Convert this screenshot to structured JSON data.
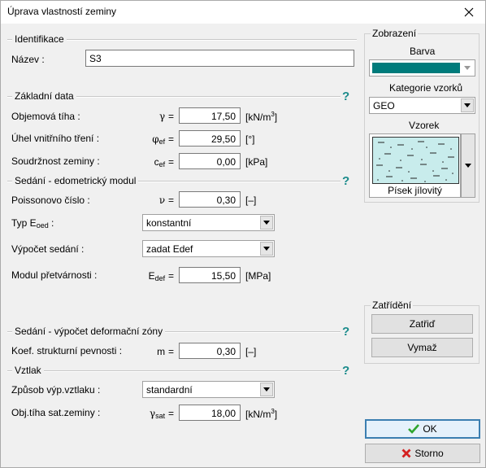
{
  "window": {
    "title": "Úprava vlastností zeminy"
  },
  "ident": {
    "section": "Identifikace",
    "name_label": "Název :",
    "name_value": "S3"
  },
  "basic": {
    "section": "Základní data",
    "help": "?",
    "unit_weight": {
      "label": "Objemová tíha :",
      "symbol": "γ",
      "eq": "=",
      "value": "17,50",
      "unit": "[kN/m",
      "unit_sup": "3",
      "unit_end": "]"
    },
    "friction": {
      "label": "Úhel vnitřního tření :",
      "symbol": "φ",
      "sub": "ef",
      "eq": "=",
      "value": "29,50",
      "unit": "[°]"
    },
    "cohesion": {
      "label": "Soudržnost zeminy :",
      "symbol": "c",
      "sub": "ef",
      "eq": "=",
      "value": "0,00",
      "unit": "[kPa]"
    }
  },
  "settle": {
    "section": "Sedání - edometrický modul",
    "help": "?",
    "poisson": {
      "label": "Poissonovo číslo :",
      "symbol": "ν",
      "eq": "=",
      "value": "0,30",
      "unit": "[–]"
    },
    "eoed_type": {
      "label": "Typ E",
      "label_sub": "oed",
      "label_end": " :",
      "value": "konstantní"
    },
    "calc": {
      "label": "Výpočet sedání :",
      "value": "zadat Edef"
    },
    "modulus": {
      "label": "Modul přetvárnosti :",
      "symbol": "E",
      "sub": "def",
      "eq": "=",
      "value": "15,50",
      "unit": "[MPa]"
    }
  },
  "zone": {
    "section": "Sedání - výpočet deformační zóny",
    "help": "?",
    "coef": {
      "label": "Koef. strukturní pevnosti :",
      "symbol": "m",
      "eq": "=",
      "value": "0,30",
      "unit": "[–]"
    }
  },
  "uplift": {
    "section": "Vztlak",
    "help": "?",
    "method": {
      "label": "Způsob výp.vztlaku :",
      "value": "standardní"
    },
    "sat": {
      "label": "Obj.tíha sat.zeminy :",
      "symbol": "γ",
      "sub": "sat",
      "eq": "=",
      "value": "18,00",
      "unit": "[kN/m",
      "unit_sup": "3",
      "unit_end": "]"
    }
  },
  "display": {
    "title": "Zobrazení",
    "color_label": "Barva",
    "color": "#007b7b",
    "category_label": "Kategorie vzorků",
    "category_value": "GEO",
    "pattern_label": "Vzorek",
    "pattern_name": "Písek jílovitý",
    "pattern_color": "#c8ecec"
  },
  "classify": {
    "title": "Zatřídění",
    "classify_btn": "Zatřiď",
    "clear_btn": "Vymaž"
  },
  "actions": {
    "ok": "OK",
    "cancel": "Storno"
  }
}
